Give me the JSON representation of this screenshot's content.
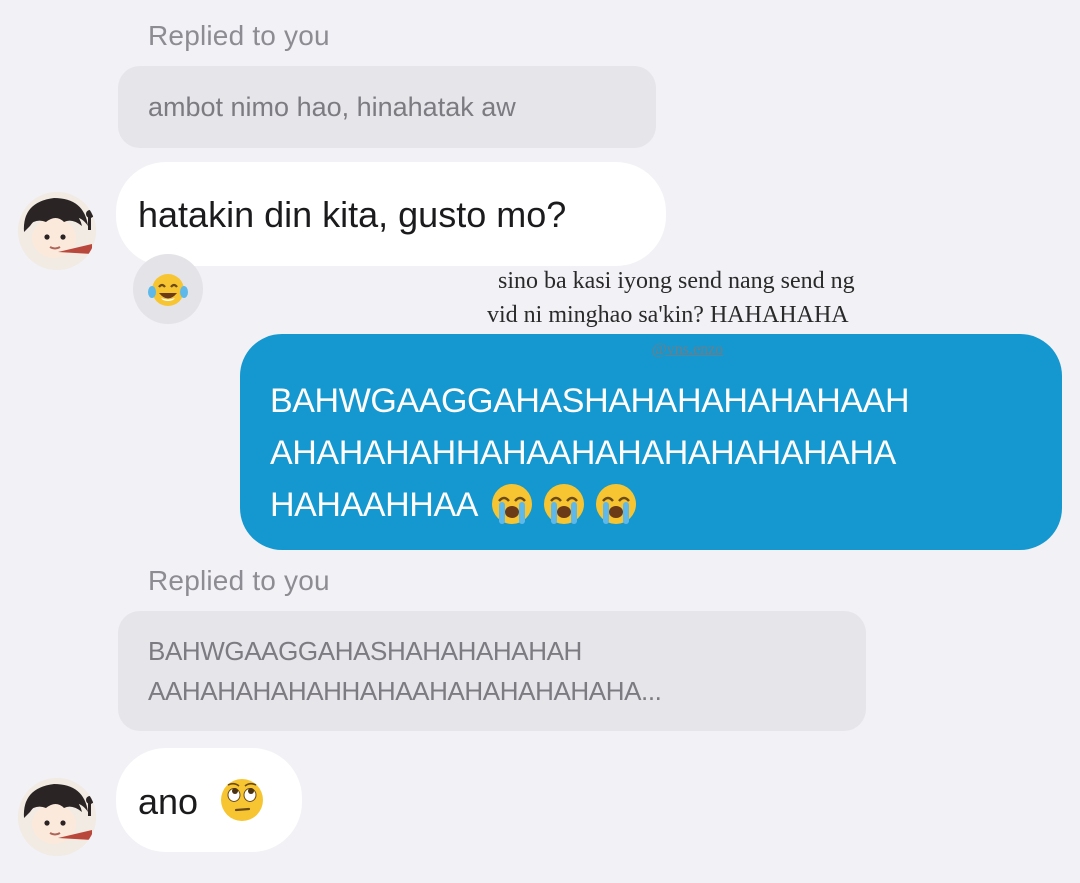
{
  "thread": {
    "reply_label_1": "Replied to you",
    "quote_1": "ambot nimo hao, hinahatak aw",
    "incoming_1": "hatakin din kita, gusto mo?",
    "reaction_1": "face-with-tears-of-joy-icon",
    "outgoing_lines": [
      "BAHWGAAGGAHASHAHAHAHAHAHAAH",
      "AHAHAHAHHAHAAHAHAHAHAHAHAHA",
      "HAHAAHHAA"
    ],
    "outgoing_emojis": [
      "loudly-crying-face-icon",
      "loudly-crying-face-icon",
      "loudly-crying-face-icon"
    ],
    "reply_label_2": "Replied to you",
    "quote_2_lines": [
      "BAHWGAAGGAHASHAHAHAHAHAH",
      "AAHAHAHAHAHHAHAAHAHAHAHAHAHA..."
    ],
    "incoming_2": "ano",
    "incoming_2_emoji": "face-with-rolling-eyes-icon"
  },
  "overlay": {
    "caption_line_1": "sino ba kasi iyong send nang send ng",
    "caption_line_2": "vid ni minghao sa'kin? HAHAHAHA",
    "watermark": "@vns.enzo"
  },
  "colors": {
    "background": "#f2f1f6",
    "outgoing_bubble": "#1598cf",
    "incoming_bubble": "#ffffff",
    "quote_box": "#e6e5ea"
  }
}
